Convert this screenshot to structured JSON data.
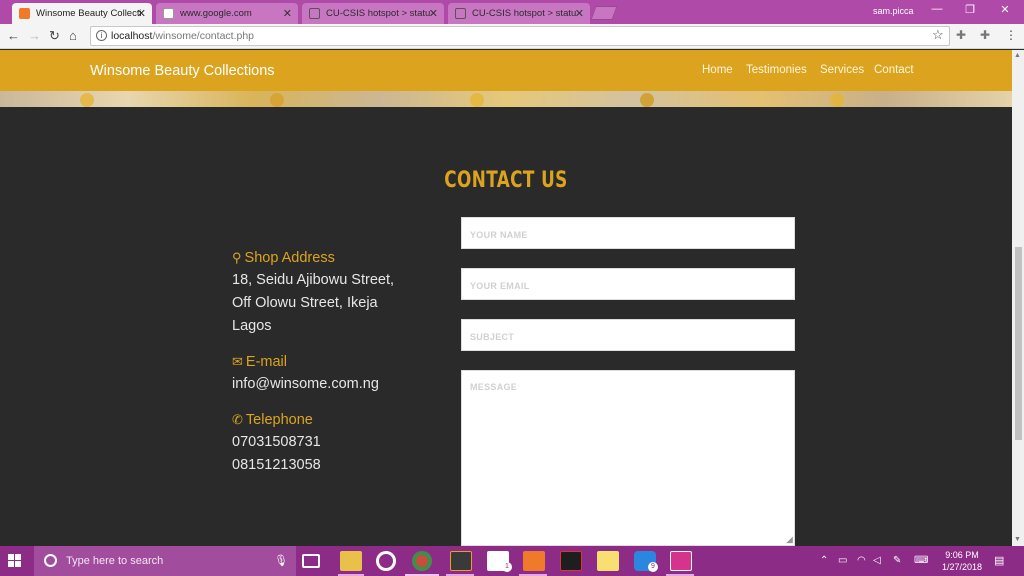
{
  "browser": {
    "tabs": [
      {
        "title": "Winsome Beauty Collecti",
        "active": true
      },
      {
        "title": "www.google.com",
        "active": false
      },
      {
        "title": "CU-CSIS hotspot > statu",
        "active": false
      },
      {
        "title": "CU-CSIS hotspot > statu",
        "active": false
      }
    ],
    "user": "sam.picca",
    "url_host": "localhost",
    "url_path": "/winsome/contact.php"
  },
  "site": {
    "brand": "Winsome Beauty Collections",
    "nav": [
      "Home",
      "Testimonies",
      "Services",
      "Contact"
    ]
  },
  "contact": {
    "heading": "CONTACT US",
    "shop_label": "Shop Address",
    "address_lines": [
      "18, Seidu Ajibowu Street,",
      "Off Olowu Street, Ikeja",
      "Lagos"
    ],
    "email_label": "E-mail",
    "email": "info@winsome.com.ng",
    "phone_label": "Telephone",
    "phones": [
      "07031508731",
      "08151213058"
    ]
  },
  "form": {
    "name_placeholder": "YOUR NAME",
    "email_placeholder": "YOUR EMAIL",
    "subject_placeholder": "SUBJECT",
    "message_placeholder": "MESSAGE"
  },
  "taskbar": {
    "search_placeholder": "Type here to search",
    "mail_badge": "1",
    "messenger_badge": "9",
    "time": "9:06 PM",
    "date": "1/27/2018"
  },
  "colors": {
    "accent": "#dca41e",
    "page_bg": "#2a2a2a",
    "tab_strip": "#b04aa8",
    "taskbar": "#8d2c87"
  },
  "icons": [
    "map-marker-icon",
    "envelope-icon",
    "phone-icon",
    "search-icon",
    "microphone-icon"
  ]
}
